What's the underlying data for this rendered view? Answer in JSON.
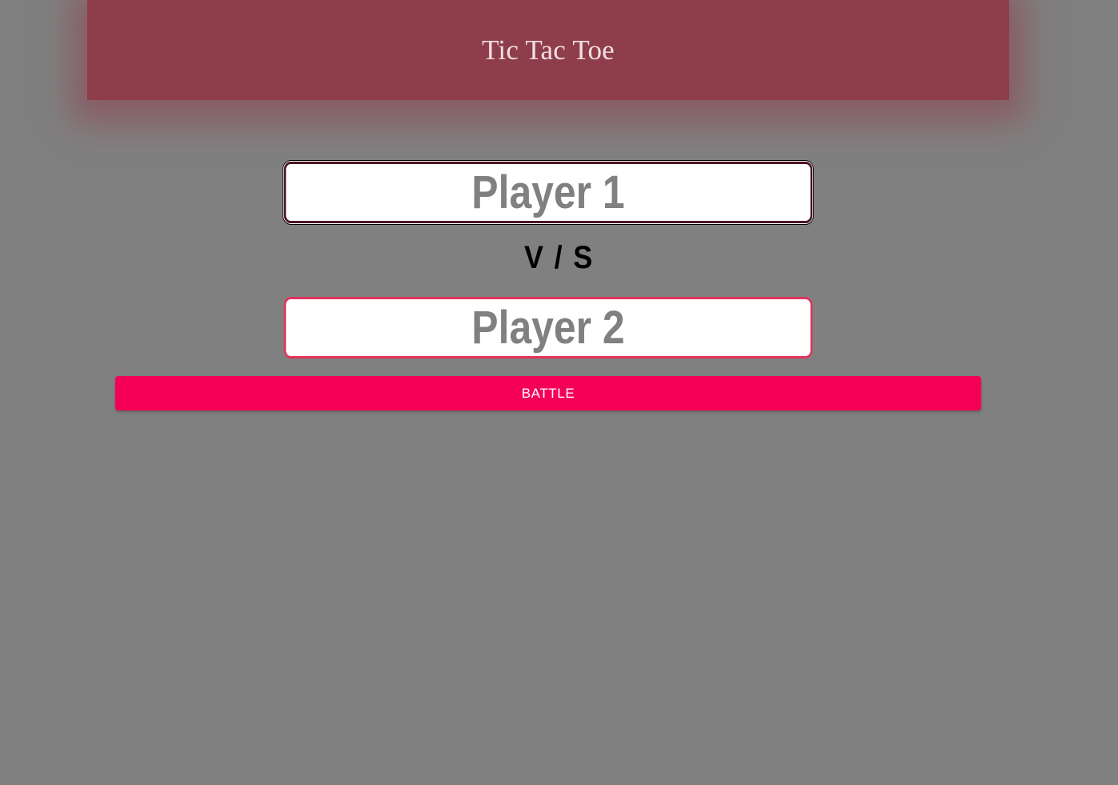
{
  "header": {
    "title": "Tic Tac Toe"
  },
  "form": {
    "player1": {
      "value": "",
      "placeholder": "Player 1"
    },
    "versus_label": "V / S",
    "player2": {
      "value": "",
      "placeholder": "Player 2"
    },
    "battle_label": "BATTLE"
  },
  "colors": {
    "background": "#808080",
    "header": "#8e3e4b",
    "header_text": "#f3dfe3",
    "accent": "#f50057",
    "input_border_focused": "#4a1420",
    "input_border": "#e0345d"
  }
}
